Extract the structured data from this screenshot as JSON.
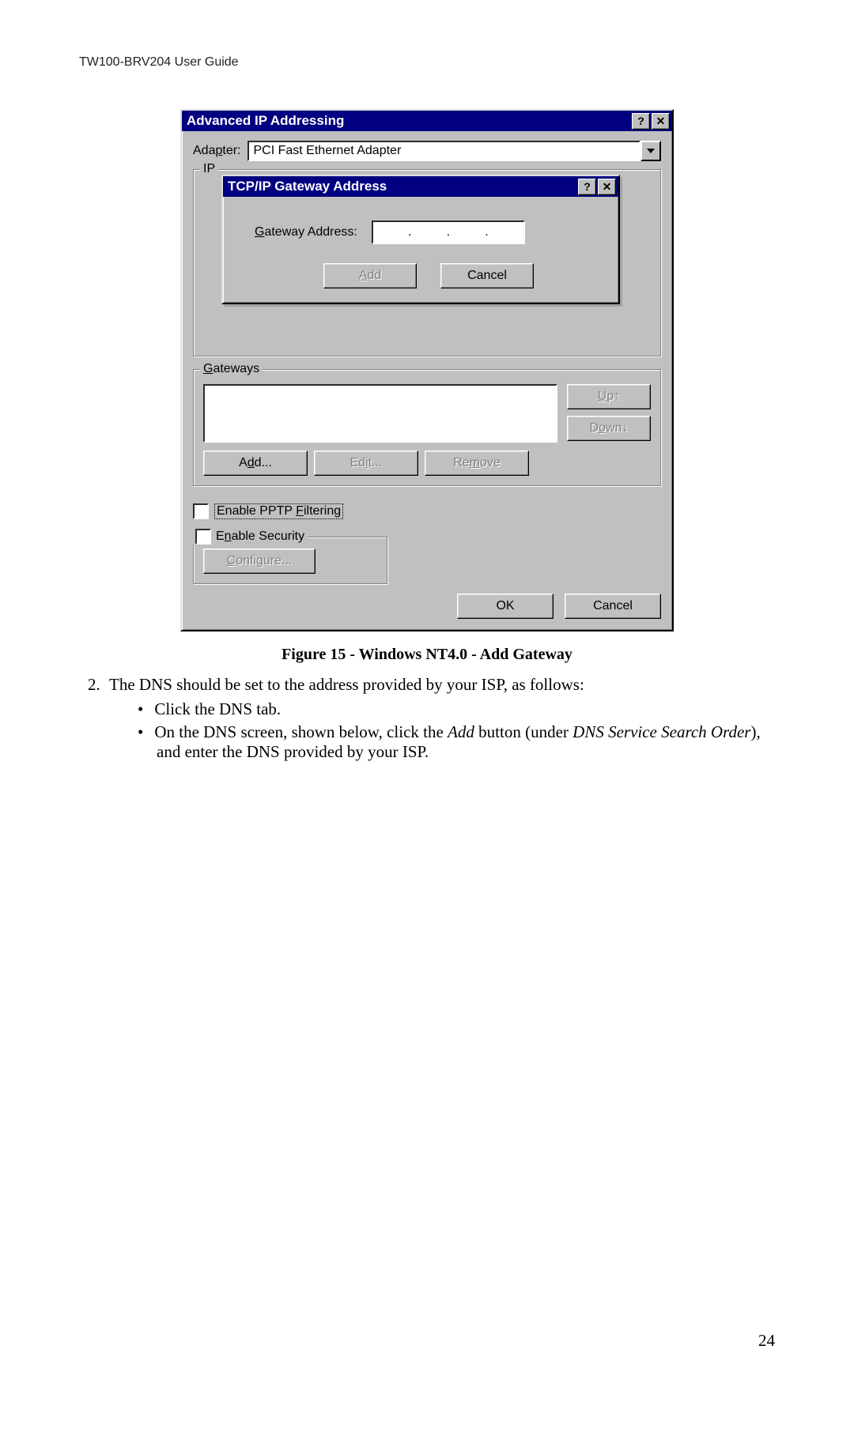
{
  "doc": {
    "header": "TW100-BRV204 User Guide",
    "page_number": "24",
    "caption": "Figure 15 - Windows NT4.0 - Add Gateway",
    "step_num": "2.",
    "step_text": "The DNS should be set to the address provided by your ISP, as follows:",
    "bullet1": "Click the DNS tab.",
    "bullet2_pre": "On the DNS screen, shown below, click the ",
    "bullet2_add": "Add",
    "bullet2_mid": " button (under ",
    "bullet2_dns": "DNS Service Search Order",
    "bullet2_post": "), and enter the DNS provided by your ISP."
  },
  "outer": {
    "title": "Advanced IP Addressing",
    "adapter_label": "Adapter:",
    "adapter_p": "p",
    "adapter_value": "PCI Fast Ethernet Adapter",
    "ip_legend": "IP",
    "gateways_legend": "Gateways",
    "gateways_g": "G",
    "up_label": "Up↑",
    "up_u": "U",
    "down_label": "Down↓",
    "down_o": "o",
    "add_label": "Add...",
    "add_d": "d",
    "edit_label": "Edit...",
    "edit_i": "i",
    "remove_label": "Remove",
    "remove_m": "m",
    "pptp_label": "Enable PPTP Filtering",
    "pptp_f": "F",
    "sec_label": "Enable Security",
    "sec_n": "n",
    "configure_label": "Configure...",
    "configure_c": "C",
    "ok": "OK",
    "cancel": "Cancel",
    "help": "?",
    "close": "✕"
  },
  "inner": {
    "title": "TCP/IP Gateway Address",
    "gw_label": "Gateway Address:",
    "gw_g": "G",
    "add": "Add",
    "add_a": "A",
    "cancel": "Cancel",
    "help": "?",
    "close": "✕"
  }
}
